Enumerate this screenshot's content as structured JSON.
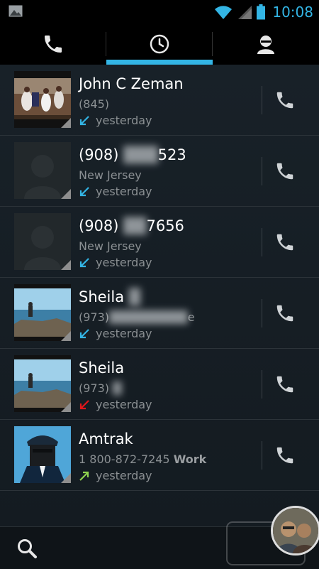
{
  "status": {
    "time": "10:08"
  },
  "tabs": [
    {
      "icon": "phone-icon",
      "selected": false
    },
    {
      "icon": "clock-icon",
      "selected": true
    },
    {
      "icon": "person-icon",
      "selected": false
    }
  ],
  "calls": [
    {
      "name": "John C Zeman",
      "number": "(845)",
      "number_type": "",
      "time": "yesterday",
      "direction": "incoming"
    },
    {
      "name_visible": "(908)",
      "name_tail": "523",
      "number": "New Jersey",
      "number_type": "",
      "time": "yesterday",
      "direction": "incoming"
    },
    {
      "name_visible": "(908)",
      "name_tail": "7656",
      "number": "New Jersey",
      "number_type": "",
      "time": "yesterday",
      "direction": "incoming"
    },
    {
      "name": "Sheila",
      "number": "(973)",
      "number_tail": "e",
      "number_type": "",
      "time": "yesterday",
      "direction": "incoming"
    },
    {
      "name": "Sheila",
      "number": "(973)",
      "number_type": "",
      "time": "yesterday",
      "direction": "missed"
    },
    {
      "name": "Amtrak",
      "number": "1 800-872-7245",
      "number_type": "Work",
      "time": "yesterday",
      "direction": "outgoing"
    }
  ],
  "colors": {
    "accent": "#33b5e5",
    "incoming_arrow": "#33b5e5",
    "missed_arrow": "#e0161b",
    "outgoing_arrow": "#8fd14f"
  }
}
